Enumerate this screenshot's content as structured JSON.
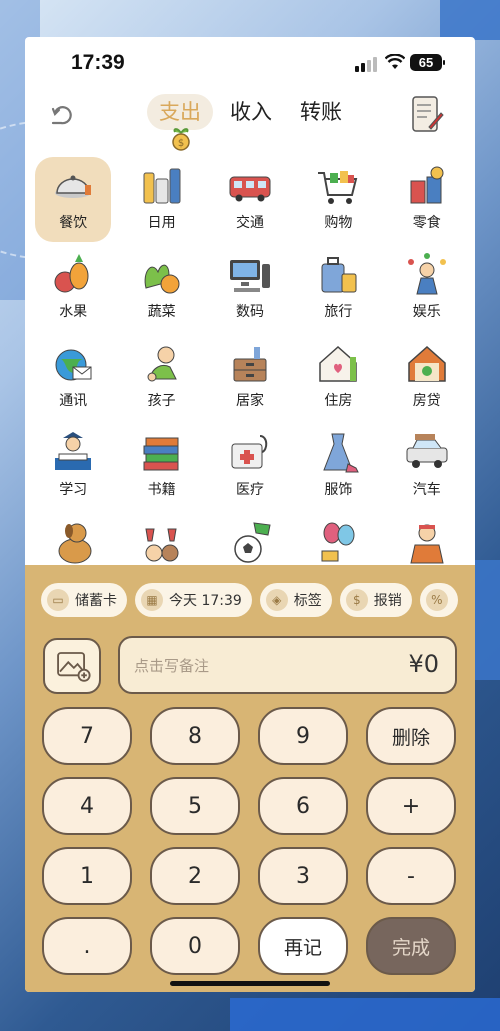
{
  "status": {
    "time": "17:39",
    "battery": "65"
  },
  "header": {
    "tabs": [
      {
        "label": "支出",
        "active": true
      },
      {
        "label": "收入",
        "active": false
      },
      {
        "label": "转账",
        "active": false
      }
    ]
  },
  "categories": [
    {
      "label": "餐饮",
      "icon": "dining-icon"
    },
    {
      "label": "日用",
      "icon": "daily-use-icon"
    },
    {
      "label": "交通",
      "icon": "bus-icon"
    },
    {
      "label": "购物",
      "icon": "shopping-cart-icon"
    },
    {
      "label": "零食",
      "icon": "snacks-icon"
    },
    {
      "label": "水果",
      "icon": "fruit-icon"
    },
    {
      "label": "蔬菜",
      "icon": "vegetables-icon"
    },
    {
      "label": "数码",
      "icon": "computer-icon"
    },
    {
      "label": "旅行",
      "icon": "luggage-icon"
    },
    {
      "label": "娱乐",
      "icon": "juggler-icon"
    },
    {
      "label": "通讯",
      "icon": "globe-mail-icon"
    },
    {
      "label": "孩子",
      "icon": "baby-icon"
    },
    {
      "label": "居家",
      "icon": "dresser-icon"
    },
    {
      "label": "住房",
      "icon": "house-icon"
    },
    {
      "label": "房贷",
      "icon": "house-money-icon"
    },
    {
      "label": "学习",
      "icon": "student-icon"
    },
    {
      "label": "书籍",
      "icon": "books-icon"
    },
    {
      "label": "医疗",
      "icon": "medical-kit-icon"
    },
    {
      "label": "服饰",
      "icon": "dress-icon"
    },
    {
      "label": "汽车",
      "icon": "car-icon"
    },
    {
      "label": "",
      "icon": "dog-icon"
    },
    {
      "label": "",
      "icon": "cheers-icon"
    },
    {
      "label": "",
      "icon": "soccer-icon"
    },
    {
      "label": "",
      "icon": "balloons-icon"
    },
    {
      "label": "",
      "icon": "courier-icon"
    }
  ],
  "chips": [
    {
      "label": "储蓄卡",
      "icon": "bank-card-icon"
    },
    {
      "label": "今天 17:39",
      "icon": "calendar-icon"
    },
    {
      "label": "标签",
      "icon": "tag-icon"
    },
    {
      "label": "报销",
      "icon": "reimburse-icon"
    },
    {
      "label": "",
      "icon": "discount-icon"
    }
  ],
  "memo": {
    "placeholder": "点击写备注",
    "amount": "¥0"
  },
  "keypad": [
    "7",
    "8",
    "9",
    "删除",
    "4",
    "5",
    "6",
    "+",
    "1",
    "2",
    "3",
    "-",
    ".",
    "0",
    "再记",
    "完成"
  ],
  "colors": {
    "accent": "#d9a85b",
    "panel": "#d8b574",
    "key": "#fbeedd",
    "done": "#77665d"
  }
}
